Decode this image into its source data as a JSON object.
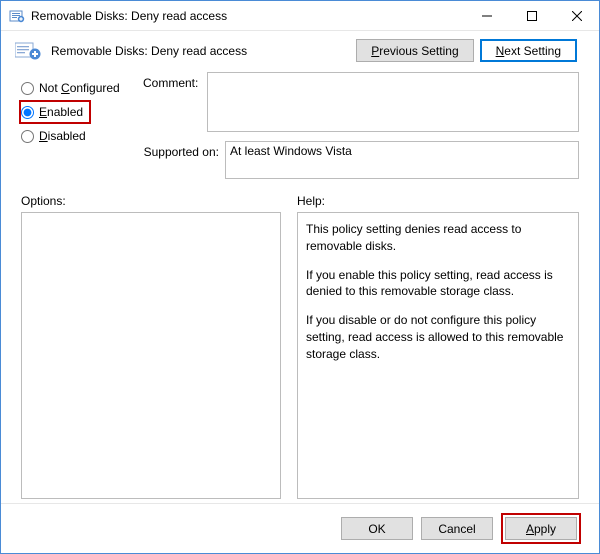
{
  "window": {
    "title": "Removable Disks: Deny read access"
  },
  "header": {
    "title": "Removable Disks: Deny read access"
  },
  "nav": {
    "previous": "Previous Setting",
    "next": "Next Setting"
  },
  "radios": {
    "not_configured": "Not Configured",
    "enabled": "Enabled",
    "disabled": "Disabled",
    "selected": "enabled"
  },
  "fields": {
    "comment_label": "Comment:",
    "comment_value": "",
    "supported_label": "Supported on:",
    "supported_value": "At least Windows Vista"
  },
  "lower": {
    "options_label": "Options:",
    "help_label": "Help:",
    "help_p1": "This policy setting denies read access to removable disks.",
    "help_p2": "If you enable this policy setting, read access is denied to this removable storage class.",
    "help_p3": "If you disable or do not configure this policy setting, read access is allowed to this removable storage class."
  },
  "footer": {
    "ok": "OK",
    "cancel": "Cancel",
    "apply": "Apply"
  }
}
